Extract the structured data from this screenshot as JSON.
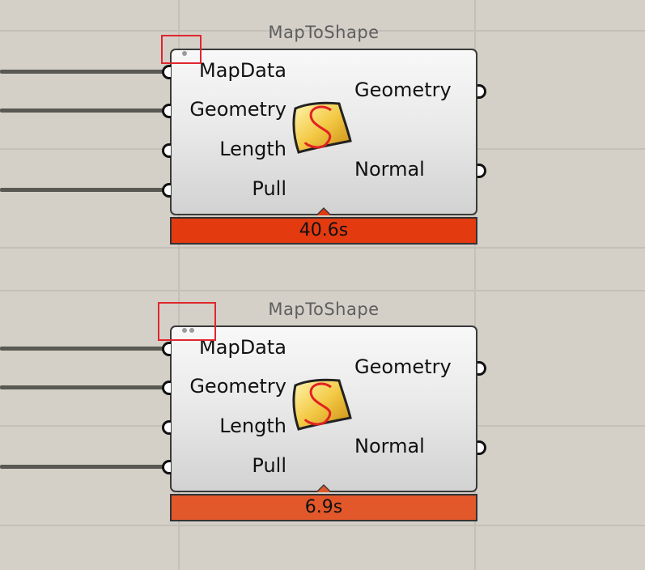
{
  "canvas": {
    "background": "#d4d0c8",
    "grid_color": "#c4c0b8"
  },
  "components": [
    {
      "title": "MapToShape",
      "inputs": [
        "MapData",
        "Geometry",
        "Length",
        "Pull"
      ],
      "outputs": [
        "Geometry",
        "Normal"
      ],
      "icon": "map-to-shape-icon",
      "timing": "40.6s",
      "timing_color": "#e33a10",
      "indicator_dots": 1,
      "highlight_color": "#e0262e"
    },
    {
      "title": "MapToShape",
      "inputs": [
        "MapData",
        "Geometry",
        "Length",
        "Pull"
      ],
      "outputs": [
        "Geometry",
        "Normal"
      ],
      "icon": "map-to-shape-icon",
      "timing": "6.9s",
      "timing_color": "#e2582a",
      "indicator_dots": 2,
      "highlight_color": "#e0262e"
    }
  ]
}
